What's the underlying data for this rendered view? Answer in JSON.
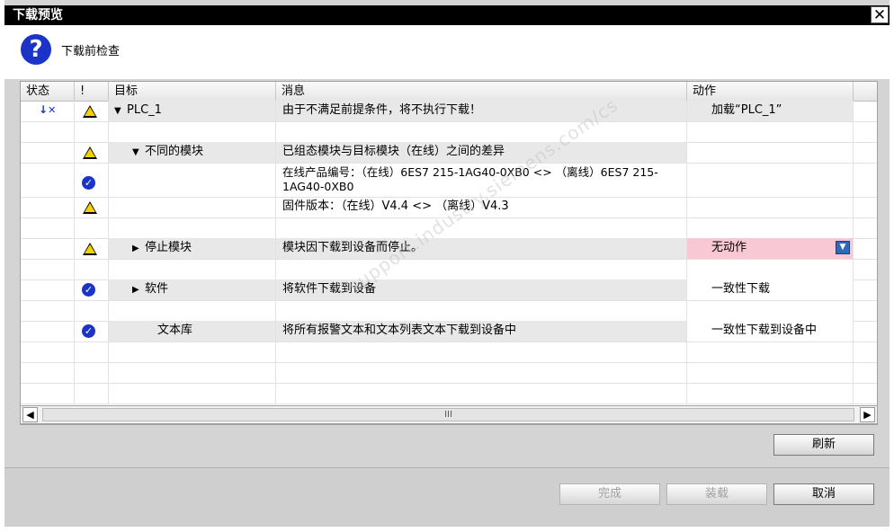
{
  "dialog": {
    "title": "下载预览",
    "close_glyph": "✕"
  },
  "header": {
    "label": "下载前检查"
  },
  "columns": {
    "status": "状态",
    "flag": "!",
    "target": "目标",
    "message": "消息",
    "action": "动作"
  },
  "rows": [
    {
      "target": "PLC_1",
      "message": "由于不满足前提条件，将不执行下载！",
      "action": "加载“PLC_1”"
    },
    {
      "target": "不同的模块",
      "message": "已组态模块与目标模块（在线）之间的差异"
    },
    {
      "message": "在线产品编号：（在线）6ES7 215-1AG40-0XB0 <> （离线）6ES7 215-1AG40-0XB0"
    },
    {
      "message": "固件版本：（在线）V4.4 <> （离线）V4.3"
    },
    {
      "target": "停止模块",
      "message": "模块因下载到设备而停止。",
      "action": "无动作"
    },
    {
      "target": "软件",
      "message": "将软件下载到设备",
      "action": "一致性下载"
    },
    {
      "target": "文本库",
      "message": "将所有报警文本和文本列表文本下载到设备中",
      "action": "一致性下载到设备中"
    }
  ],
  "scrollbar": {
    "thumb_label": "III"
  },
  "buttons": {
    "refresh": "刷新",
    "finish": "完成",
    "load": "装载",
    "cancel": "取消"
  },
  "watermark": "support.industry.siemens.com/cs",
  "colors": {
    "warning": "#f5d000",
    "ok": "#1a34c7",
    "action_highlight": "#f8c8d4"
  }
}
